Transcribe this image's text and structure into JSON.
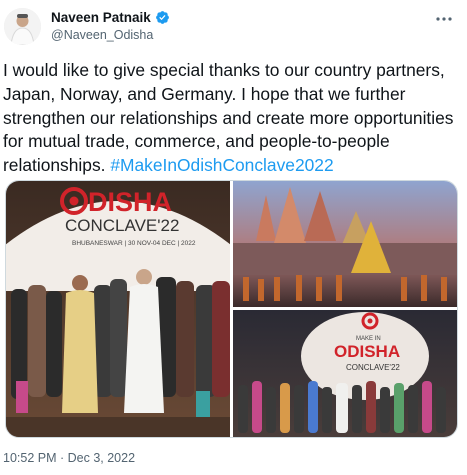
{
  "author": {
    "name": "Naveen Patnaik",
    "handle": "@Naveen_Odisha",
    "verified_color": "#1d9bf0"
  },
  "tweet": {
    "text": "I would like to give special thanks to our country partners, Japan, Norway, and Germany. I hope that we further strengthen our relationships and create more opportunities for mutual trade, commerce, and people-to-people relationships.",
    "hashtag": "#MakeInOdishConclave2022"
  },
  "media": {
    "photo1": {
      "brand": "ODISHA",
      "brand_O": "O",
      "brand_rest": "DISHA",
      "subtitle": "CONCLAVE'22",
      "dates": "BHUBANESWAR | 30 NOV-04 DEC | 2022"
    },
    "photo3": {
      "small": "MAKE IN",
      "brand": "ODISHA",
      "sub": "CONCLAVE'22"
    }
  },
  "timestamp": "10:52 PM · Dec 3, 2022",
  "icons": {
    "verified": "verified-badge-icon",
    "more": "more-options-icon"
  },
  "colors": {
    "accent": "#1d9bf0",
    "brand_red": "#d1232a",
    "secondary_text": "#536471"
  }
}
